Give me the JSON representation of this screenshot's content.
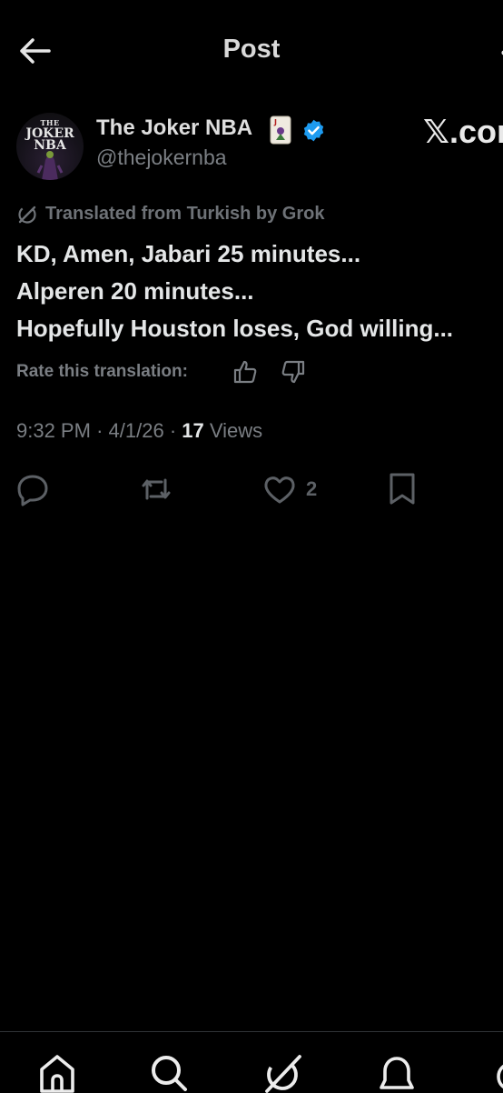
{
  "header": {
    "title": "Post"
  },
  "author": {
    "display_name": "The Joker NBA",
    "handle": "@thejokernba",
    "avatar_text": [
      "THE",
      "JOKER",
      "NBA"
    ],
    "verified_color": "#1d9bf0"
  },
  "watermark": "𝕏.com",
  "translation": {
    "label": "Translated from Turkish by Grok",
    "lines": [
      "KD, Amen, Jabari 25 minutes...",
      "Alperen 20 minutes...",
      "Hopefully Houston loses, God willing..."
    ],
    "rate_label": "Rate this translation:"
  },
  "meta": {
    "time": "9:32 PM",
    "date": "4/1/26",
    "views_count": "17",
    "views_label": "Views"
  },
  "actions": {
    "like_count": "2"
  },
  "icons": {
    "back": "arrow-left-icon",
    "more": "more-icon",
    "grok": "grok-icon",
    "reply": "reply-icon",
    "repost": "repost-icon",
    "like": "heart-icon",
    "bookmark": "bookmark-icon",
    "nav": [
      "home-icon",
      "search-icon",
      "grok-icon",
      "notifications-icon",
      "messages-icon"
    ]
  }
}
